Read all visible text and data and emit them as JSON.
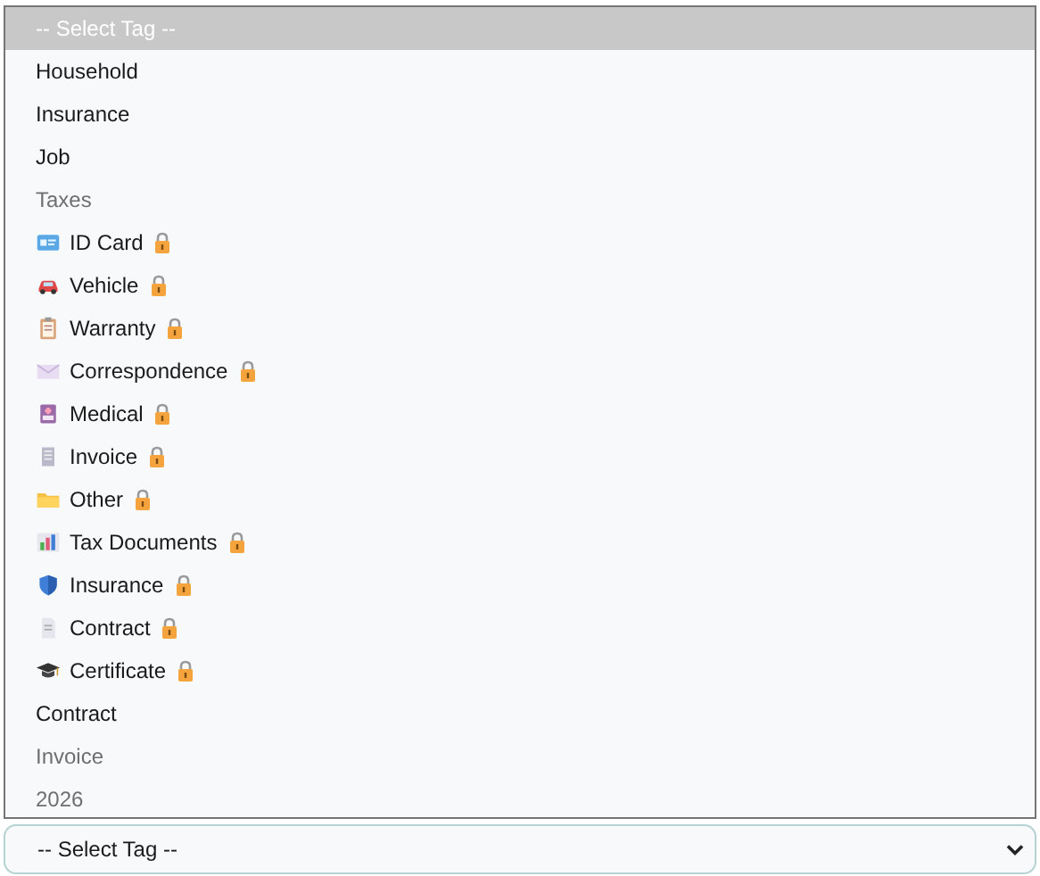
{
  "listbox": {
    "options": [
      {
        "label": "-- Select Tag --",
        "selected": true,
        "disabled": false,
        "kind": "plain"
      },
      {
        "label": "Household",
        "selected": false,
        "disabled": false,
        "kind": "plain"
      },
      {
        "label": "Insurance",
        "selected": false,
        "disabled": false,
        "kind": "plain"
      },
      {
        "label": "Job",
        "selected": false,
        "disabled": false,
        "kind": "plain"
      },
      {
        "label": "Taxes",
        "selected": false,
        "disabled": true,
        "kind": "plain"
      },
      {
        "label": "ID Card",
        "selected": false,
        "disabled": false,
        "kind": "locked"
      },
      {
        "label": "Vehicle",
        "selected": false,
        "disabled": false,
        "kind": "locked"
      },
      {
        "label": "Warranty",
        "selected": false,
        "disabled": false,
        "kind": "locked"
      },
      {
        "label": "Correspondence",
        "selected": false,
        "disabled": false,
        "kind": "locked"
      },
      {
        "label": "Medical",
        "selected": false,
        "disabled": false,
        "kind": "locked"
      },
      {
        "label": "Invoice",
        "selected": false,
        "disabled": false,
        "kind": "locked"
      },
      {
        "label": "Other",
        "selected": false,
        "disabled": false,
        "kind": "locked"
      },
      {
        "label": "Tax Documents",
        "selected": false,
        "disabled": false,
        "kind": "locked"
      },
      {
        "label": "Insurance",
        "selected": false,
        "disabled": false,
        "kind": "locked"
      },
      {
        "label": "Contract",
        "selected": false,
        "disabled": false,
        "kind": "locked"
      },
      {
        "label": "Certificate",
        "selected": false,
        "disabled": false,
        "kind": "locked"
      },
      {
        "label": "Contract",
        "selected": false,
        "disabled": false,
        "kind": "plain"
      },
      {
        "label": "Invoice",
        "selected": false,
        "disabled": true,
        "kind": "plain"
      },
      {
        "label": "2026",
        "selected": false,
        "disabled": true,
        "kind": "plain"
      }
    ]
  },
  "select": {
    "value": "-- Select Tag --"
  }
}
